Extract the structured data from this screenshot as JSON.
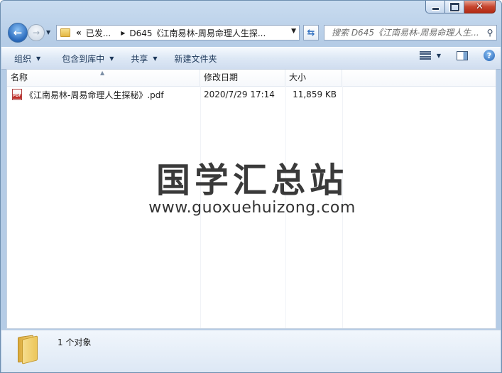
{
  "window": {
    "controls": {
      "minimize": "minimize",
      "maximize": "maximize",
      "close": "close"
    }
  },
  "nav": {
    "breadcrumb_prefix": "«",
    "breadcrumb_parent": "已发...",
    "breadcrumb_current": "D645《江南易林-周易命理人生探...",
    "search_placeholder": "搜索 D645《江南易林-周易命理人生..."
  },
  "toolbar": {
    "organize": "组织",
    "include_library": "包含到库中",
    "share": "共享",
    "new_folder": "新建文件夹"
  },
  "columns": {
    "name": "名称",
    "date": "修改日期",
    "size": "大小"
  },
  "files": [
    {
      "name": "《江南易林-周易命理人生探秘》.pdf",
      "date": "2020/7/29 17:14",
      "size": "11,859 KB"
    }
  ],
  "watermark": {
    "title": "国学汇总站",
    "url": "www.guoxuehuizong.com"
  },
  "details": {
    "count": "1 个对象"
  },
  "colors": {
    "accent": "#2f6fc0",
    "close": "#c7452e",
    "window_frame": "#b5cce6"
  }
}
